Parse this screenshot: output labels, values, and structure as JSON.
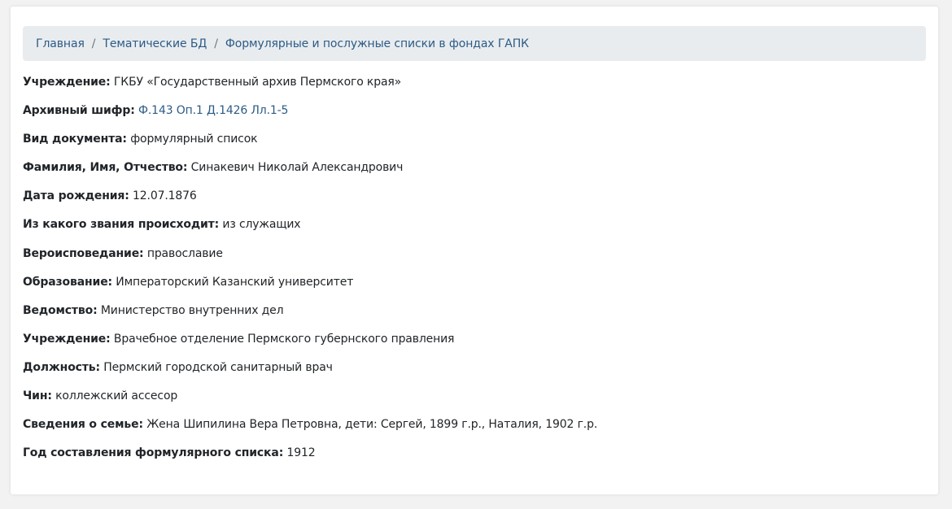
{
  "breadcrumb": {
    "items": [
      "Главная",
      "Тематические БД",
      "Формулярные и послужные списки в фондах ГАПК"
    ],
    "separator": "/"
  },
  "record": {
    "institution": {
      "label": "Учреждение:",
      "value": "ГКБУ «Государственный архив Пермского края»"
    },
    "archive_code": {
      "label": "Архивный шифр:",
      "value": "Ф.143 Оп.1 Д.1426 Лл.1-5"
    },
    "doc_type": {
      "label": "Вид документа:",
      "value": "формулярный список"
    },
    "full_name": {
      "label": "Фамилия, Имя, Отчество:",
      "value": "Синакевич Николай Александрович"
    },
    "birth_date": {
      "label": "Дата рождения:",
      "value": "12.07.1876"
    },
    "origin": {
      "label": "Из какого звания происходит:",
      "value": "из служащих"
    },
    "religion": {
      "label": "Вероисповедание:",
      "value": "православие"
    },
    "education": {
      "label": "Образование:",
      "value": "Императорский Казанский университет"
    },
    "department": {
      "label": "Ведомство:",
      "value": "Министерство внутренних дел"
    },
    "employer": {
      "label": "Учреждение:",
      "value": "Врачебное отделение Пермского губернского правления"
    },
    "position": {
      "label": "Должность:",
      "value": "Пермский городской санитарный врач"
    },
    "rank": {
      "label": "Чин:",
      "value": "коллежский ассесор"
    },
    "family": {
      "label": "Сведения о семье:",
      "value": "Жена Шипилина Вера Петровна, дети: Сергей, 1899 г.р., Наталия, 1902 г.р."
    },
    "year_compiled": {
      "label": "Год составления формулярного списка:",
      "value": "1912"
    }
  },
  "colors": {
    "link": "#2c5b86",
    "text": "#212529",
    "breadcrumb_bg": "#e9ecef",
    "page_bg": "#f2f2f2",
    "card_bg": "#ffffff"
  }
}
